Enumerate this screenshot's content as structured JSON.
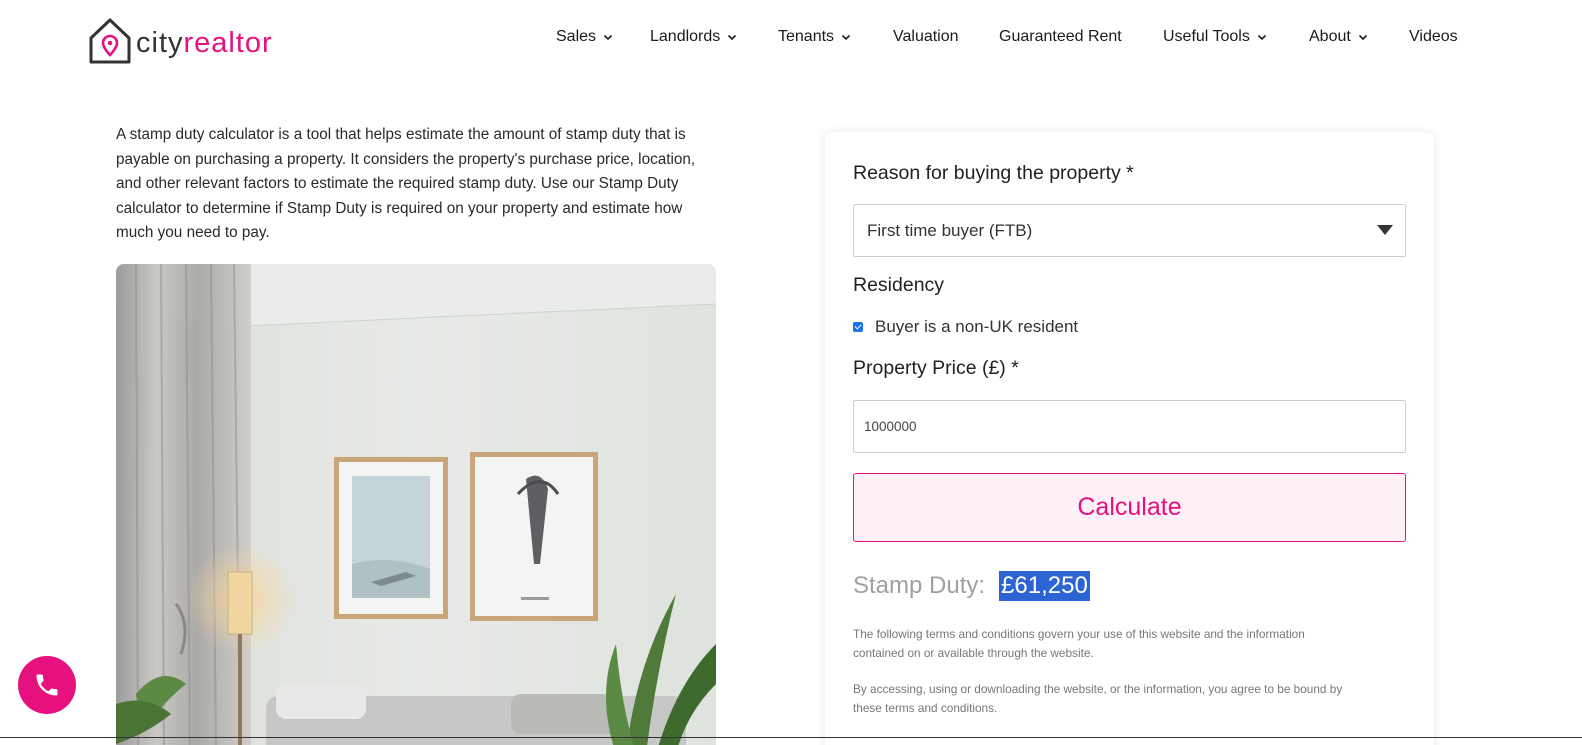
{
  "brand": {
    "city": "city",
    "realtor": "realtor",
    "accent": "#e6117e"
  },
  "nav": {
    "items": [
      {
        "label": "Sales",
        "dropdown": true
      },
      {
        "label": "Landlords",
        "dropdown": true
      },
      {
        "label": "Tenants",
        "dropdown": true
      },
      {
        "label": "Valuation",
        "dropdown": false
      },
      {
        "label": "Guaranteed Rent",
        "dropdown": false
      },
      {
        "label": "Useful Tools",
        "dropdown": true
      },
      {
        "label": "About",
        "dropdown": true
      },
      {
        "label": "Videos",
        "dropdown": false
      }
    ]
  },
  "intro": {
    "lines": [
      "A stamp duty calculator is a tool that helps estimate the amount of stamp duty that is",
      "payable on purchasing a property. It considers the property's purchase price, location,",
      "and other relevant factors to estimate the required stamp duty. Use our Stamp Duty",
      "calculator to determine if Stamp Duty is required on your property and estimate how",
      "much you need to pay."
    ]
  },
  "form": {
    "reason_label": "Reason for buying the property *",
    "reason_value": "First time buyer (FTB)",
    "residency_label": "Residency",
    "residency_checkbox_label": "Buyer is a non-UK resident",
    "residency_checked": true,
    "price_label": "Property Price (£) *",
    "price_value": "1000000",
    "calculate_label": "Calculate",
    "result_label": "Stamp Duty:",
    "result_value": "£61,250",
    "terms_1_line1": "The following terms and conditions govern your use of this website and the information",
    "terms_1_line2": "contained on or available through the website.",
    "terms_2_line1": "By accessing, using or downloading the website, or the information, you agree to be bound by",
    "terms_2_line2": "these terms and conditions."
  },
  "icons": {
    "logo": "house-pin-icon",
    "phone": "phone-icon",
    "chevron": "chevron-down-icon",
    "caret": "caret-down-icon"
  }
}
